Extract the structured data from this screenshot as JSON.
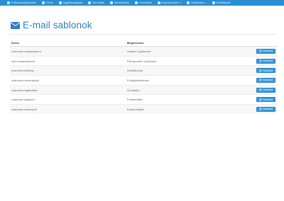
{
  "nav": [
    {
      "label": "Felhasználókezelés",
      "caret": false
    },
    {
      "label": "Hírek",
      "caret": false
    },
    {
      "label": "Ügyfélszolgálat",
      "caret": false
    },
    {
      "label": "Termékek",
      "caret": false
    },
    {
      "label": "Rendelések",
      "caret": false
    },
    {
      "label": "Készletek",
      "caret": false
    },
    {
      "label": "Export/Import",
      "caret": true
    },
    {
      "label": "Statisztika",
      "caret": true
    },
    {
      "label": "Beállítások",
      "caret": false
    }
  ],
  "page": {
    "title": "E-mail sablonok",
    "icon": "envelope-icon"
  },
  "table": {
    "headers": {
      "key": "Kulcs",
      "name": "Megnevezés"
    },
    "edit_label": "Módosít",
    "rows": [
      {
        "key": "customer.newpassword",
        "name": "Vásárló új jelszava"
      },
      {
        "key": "user.newpassword",
        "name": "Felhasználó új jelszava"
      },
      {
        "key": "customer.birthday",
        "name": "Születésnap"
      },
      {
        "key": "customer.presentpoint",
        "name": "Pontajándékozás"
      },
      {
        "key": "customer.registration",
        "name": "Új vásárló"
      },
      {
        "key": "customer.addpoint",
        "name": "Pontfeltöltés"
      },
      {
        "key": "customer.cardexpire",
        "name": "Kártya lejárat"
      }
    ]
  },
  "colors": {
    "accent": "#2a8fd2",
    "title": "#2a7fc4",
    "button": "#3498db"
  }
}
